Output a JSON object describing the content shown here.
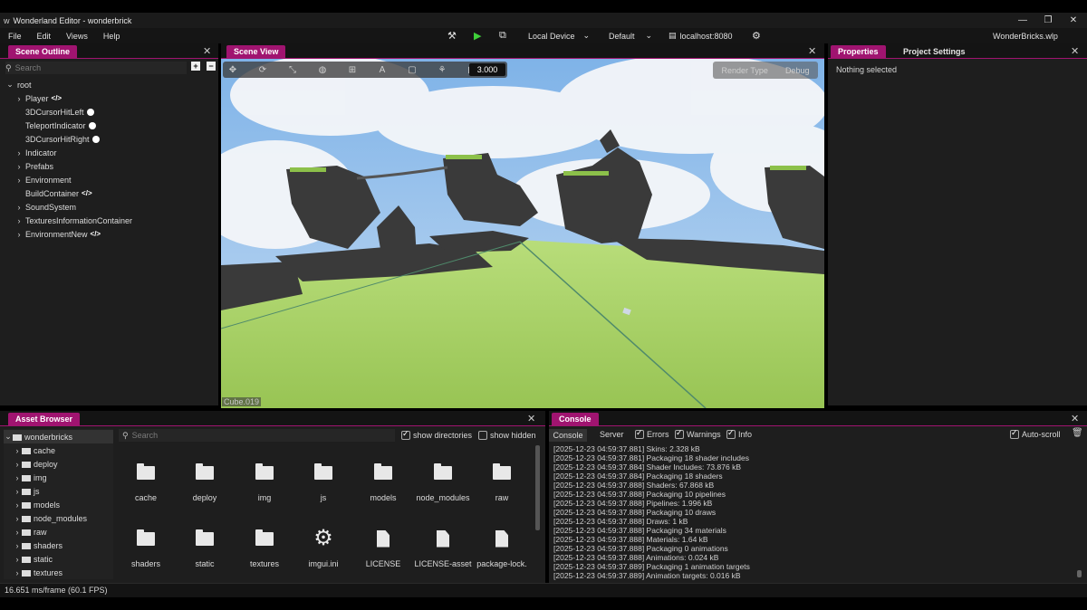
{
  "window": {
    "title": "Wonderland Editor - wonderbrick"
  },
  "menu": [
    "File",
    "Edit",
    "Views",
    "Help"
  ],
  "toolbar": {
    "device": "Local Device",
    "profile": "Default",
    "server": "localhost:8080",
    "project_file": "WonderBricks.wlp"
  },
  "scene_outline": {
    "tab": "Scene Outline",
    "search_placeholder": "Search",
    "items": [
      {
        "label": "root"
      },
      {
        "label": "Player"
      },
      {
        "label": "3DCursorHitLeft"
      },
      {
        "label": "TeleportIndicator"
      },
      {
        "label": "3DCursorHitRight"
      },
      {
        "label": "Indicator"
      },
      {
        "label": "Prefabs"
      },
      {
        "label": "Environment"
      },
      {
        "label": "BuildContainer"
      },
      {
        "label": "SoundSystem"
      },
      {
        "label": "TexturesInformationContainer"
      },
      {
        "label": "EnvironmentNew"
      }
    ]
  },
  "scene_view": {
    "tab": "Scene View",
    "zoom": "3.000",
    "render_type": "Render Type",
    "debug": "Debug",
    "selected_object": "Cube.019"
  },
  "properties": {
    "tab_properties": "Properties",
    "tab_project_settings": "Project Settings",
    "empty_text": "Nothing selected"
  },
  "asset_browser": {
    "tab": "Asset Browser",
    "search_placeholder": "Search",
    "show_directories": "show directories",
    "show_hidden": "show hidden",
    "tree_root": "wonderbricks",
    "tree": [
      "cache",
      "deploy",
      "img",
      "js",
      "models",
      "node_modules",
      "raw",
      "shaders",
      "static",
      "textures"
    ],
    "grid": [
      "cache",
      "deploy",
      "img",
      "js",
      "models",
      "node_modules",
      "raw",
      "shaders",
      "static",
      "textures",
      "imgui.ini",
      "LICENSE",
      "LICENSE-asset",
      "package-lock."
    ]
  },
  "console": {
    "tab": "Console",
    "subtabs": {
      "console": "Console",
      "server": "Server"
    },
    "filters": {
      "errors": "Errors",
      "warnings": "Warnings",
      "info": "Info"
    },
    "autoscroll": "Auto-scroll",
    "lines": [
      "[2025-12-23 04:59:37.881] Skins: 2.328 kB",
      "[2025-12-23 04:59:37.881] Packaging 18 shader includes",
      "[2025-12-23 04:59:37.884] Shader Includes: 73.876 kB",
      "[2025-12-23 04:59:37.884] Packaging 18 shaders",
      "[2025-12-23 04:59:37.888] Shaders: 67.868 kB",
      "[2025-12-23 04:59:37.888] Packaging 10 pipelines",
      "[2025-12-23 04:59:37.888] Pipelines: 1.996 kB",
      "[2025-12-23 04:59:37.888] Packaging 10 draws",
      "[2025-12-23 04:59:37.888] Draws: 1 kB",
      "[2025-12-23 04:59:37.888] Packaging 34 materials",
      "[2025-12-23 04:59:37.888] Materials: 1.64 kB",
      "[2025-12-23 04:59:37.888] Packaging 0 animations",
      "[2025-12-23 04:59:37.888] Animations: 0.024 kB",
      "[2025-12-23 04:59:37.889] Packaging 1 animation targets",
      "[2025-12-23 04:59:37.889] Animation targets: 0.016 kB"
    ]
  },
  "status": {
    "fps": "16.651 ms/frame (60.1 FPS)"
  },
  "colors": {
    "accent": "#a01470",
    "panel": "#1e1e1e",
    "background": "#141414",
    "play": "#3fd13a"
  }
}
